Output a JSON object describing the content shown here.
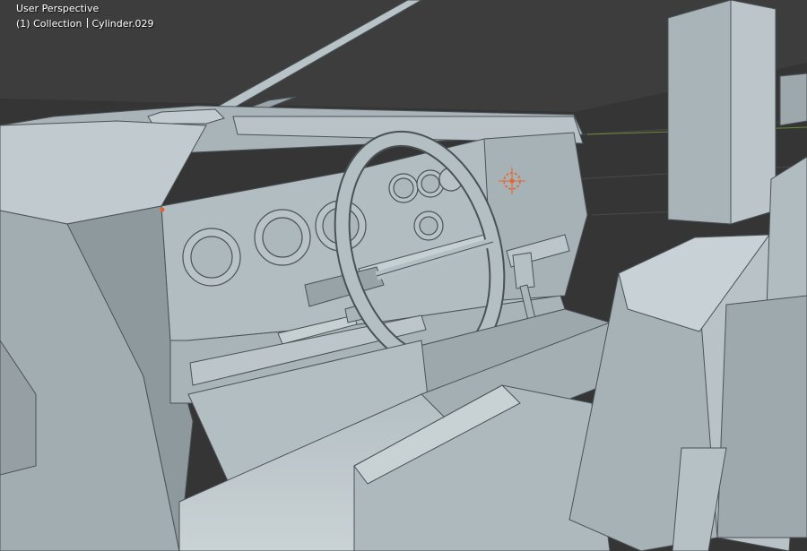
{
  "viewport": {
    "mode_label": "User Perspective",
    "frame_collection": "(1) Collection",
    "active_object": "Cylinder.029",
    "background_color": "#3d3d3d",
    "mesh_color": "#a3aeb2",
    "wire_color": "#4a5256",
    "origin_color": "#e8632a"
  }
}
